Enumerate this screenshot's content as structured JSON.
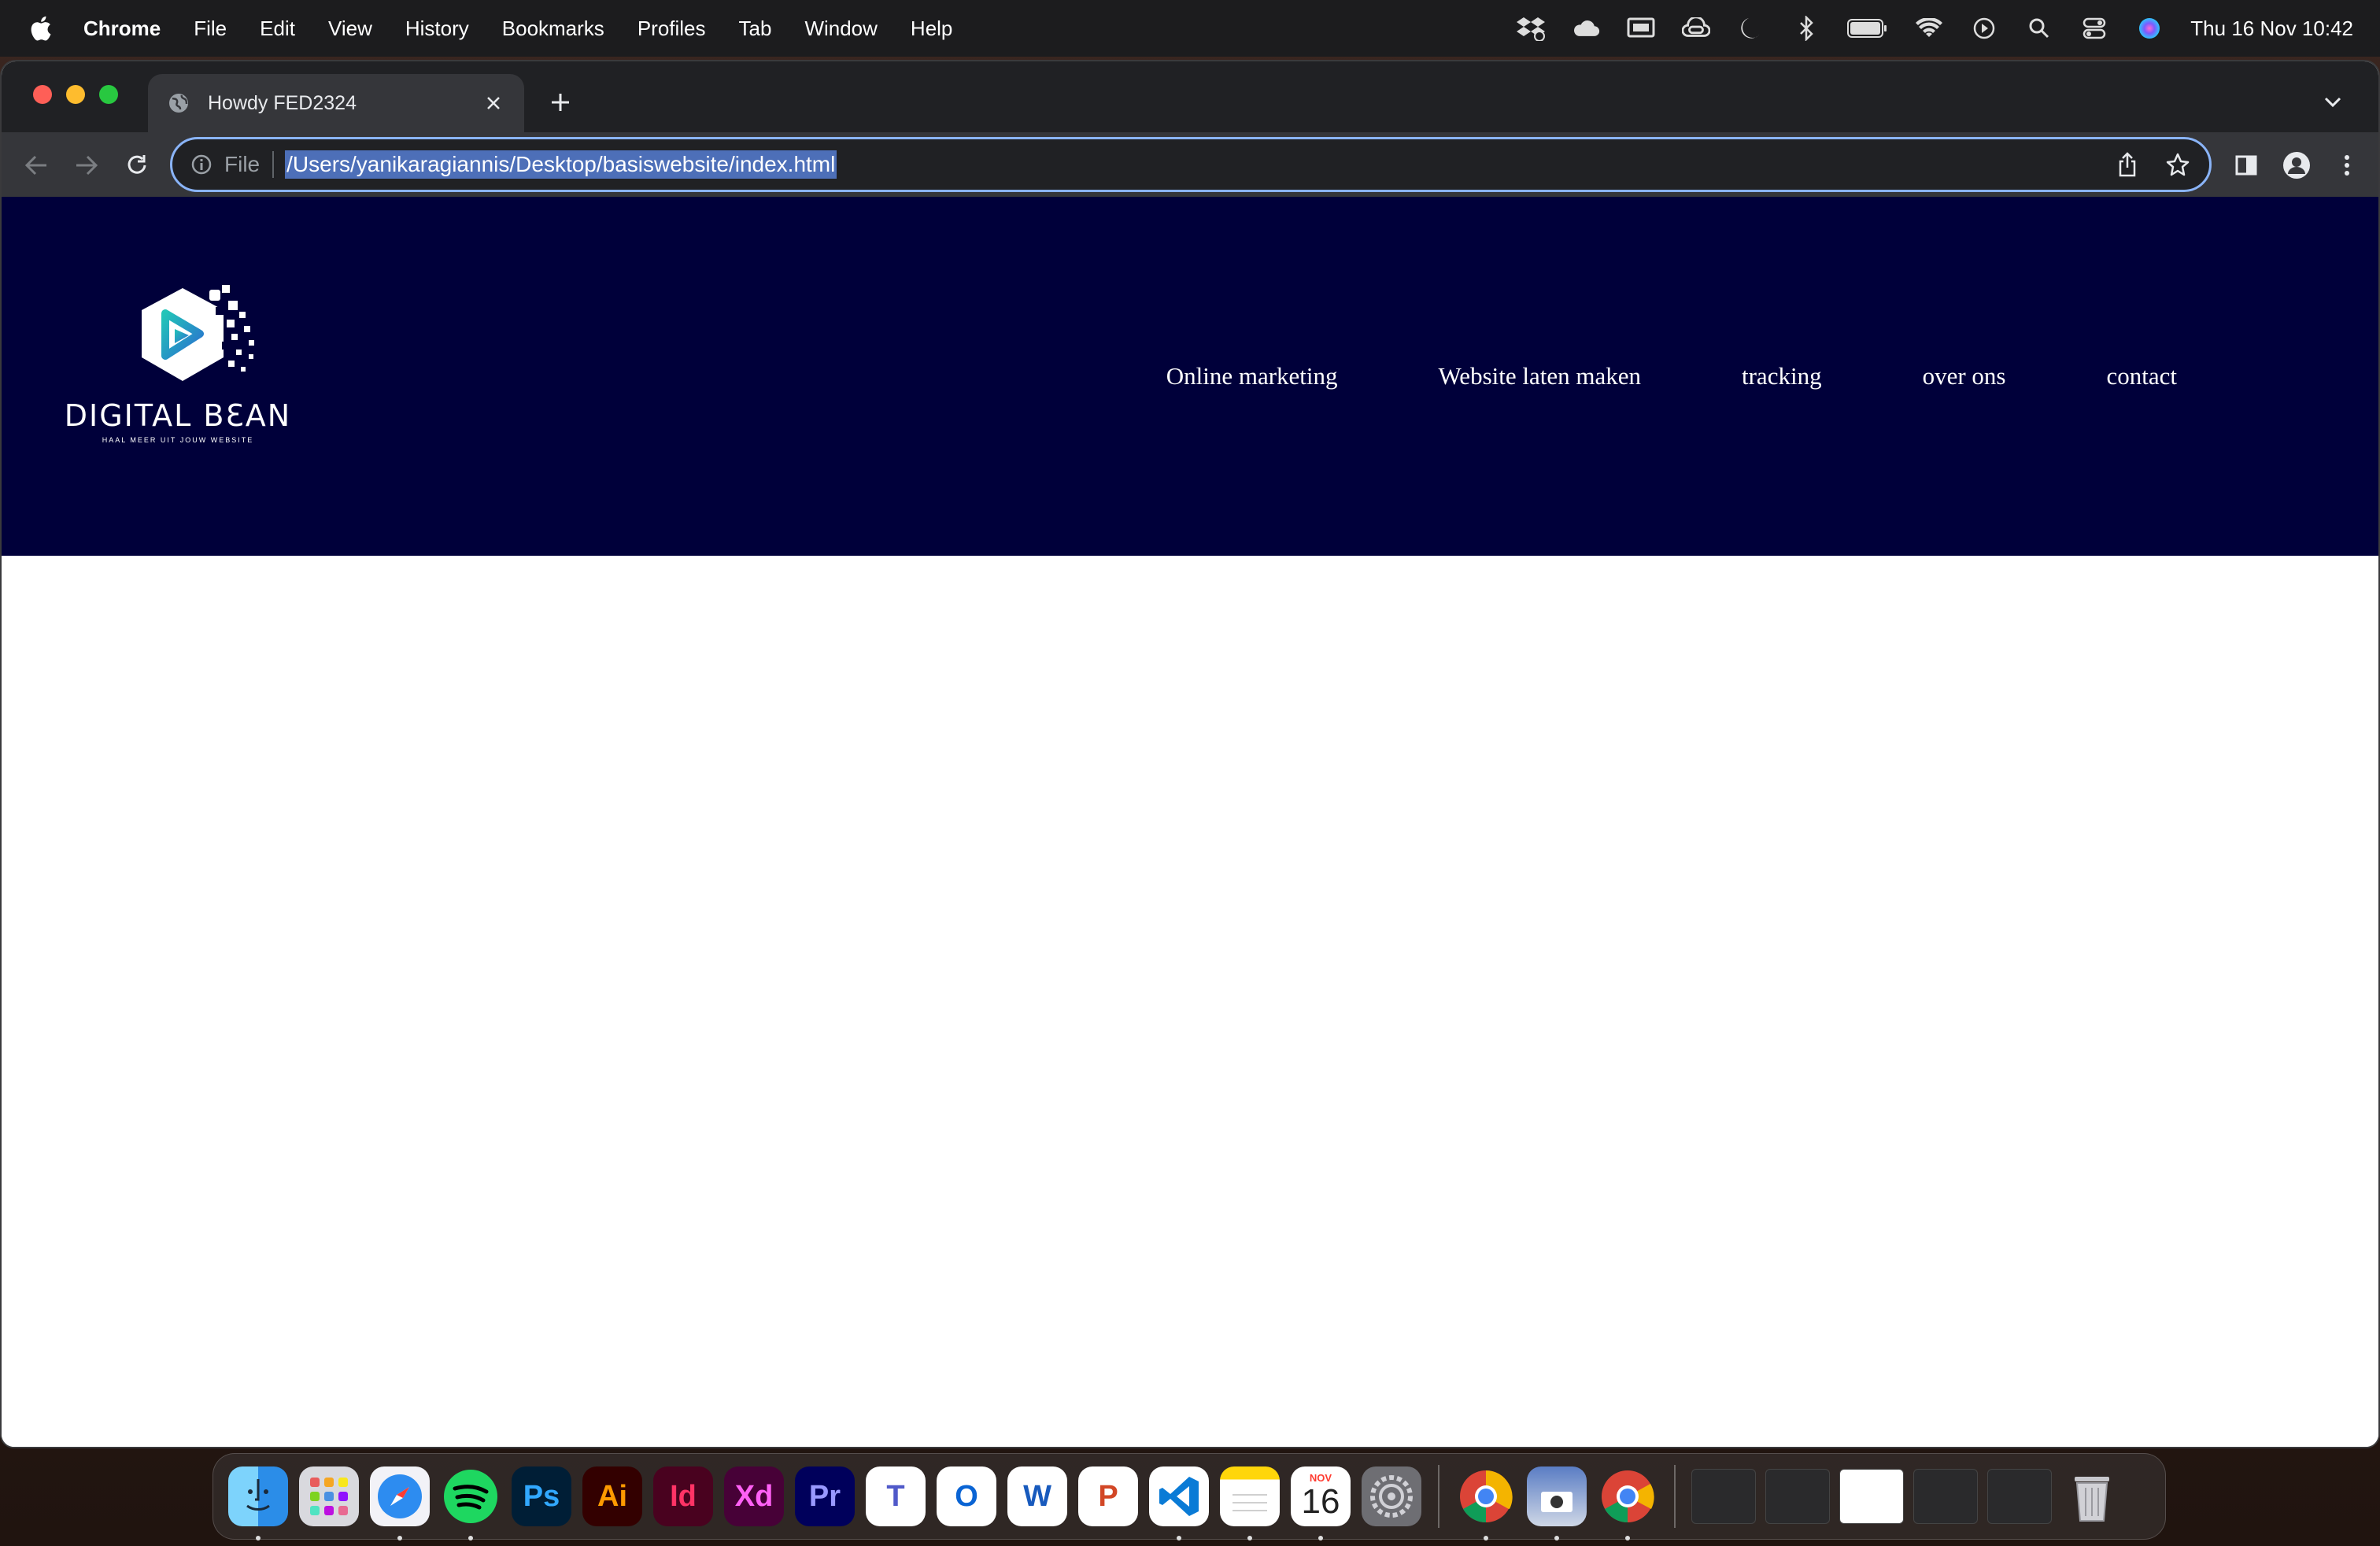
{
  "menubar": {
    "app_name": "Chrome",
    "menus": [
      "File",
      "Edit",
      "View",
      "History",
      "Bookmarks",
      "Profiles",
      "Tab",
      "Window",
      "Help"
    ],
    "tray_icons": [
      "dropbox-icon",
      "cloud-icon",
      "screen-mirror-icon",
      "creative-cloud-icon",
      "moon-icon",
      "bluetooth-icon",
      "battery-icon",
      "wifi-icon",
      "play-icon",
      "search-icon",
      "control-center-icon",
      "siri-icon"
    ],
    "clock": "Thu 16 Nov  10:42"
  },
  "browser": {
    "tab_title": "Howdy FED2324",
    "address_scheme": "File",
    "address_url": "/Users/yanikaragiannis/Desktop/basiswebsite/index.html"
  },
  "site": {
    "logo_text": "DIGITAL BƐAN",
    "logo_tagline": "HAAL MEER UIT JOUW WEBSITE",
    "nav": [
      "Online marketing",
      "Website laten maken",
      "tracking",
      "over ons",
      "contact"
    ],
    "header_color": "#00003a"
  },
  "dock": {
    "apps": [
      {
        "name": "finder",
        "label": ""
      },
      {
        "name": "launchpad",
        "label": ""
      },
      {
        "name": "safari",
        "label": ""
      },
      {
        "name": "spotify",
        "label": ""
      },
      {
        "name": "photoshop",
        "label": "Ps"
      },
      {
        "name": "illustrator",
        "label": "Ai"
      },
      {
        "name": "indesign",
        "label": "Id"
      },
      {
        "name": "xd",
        "label": "Xd"
      },
      {
        "name": "premiere",
        "label": "Pr"
      },
      {
        "name": "teams",
        "label": "T"
      },
      {
        "name": "outlook",
        "label": "O"
      },
      {
        "name": "word",
        "label": "W"
      },
      {
        "name": "powerpoint",
        "label": "P"
      },
      {
        "name": "vscode",
        "label": ""
      },
      {
        "name": "notes",
        "label": ""
      },
      {
        "name": "calendar",
        "label": "16"
      },
      {
        "name": "system-settings",
        "label": ""
      }
    ],
    "calendar_month": "NOV",
    "calendar_day": "16"
  }
}
